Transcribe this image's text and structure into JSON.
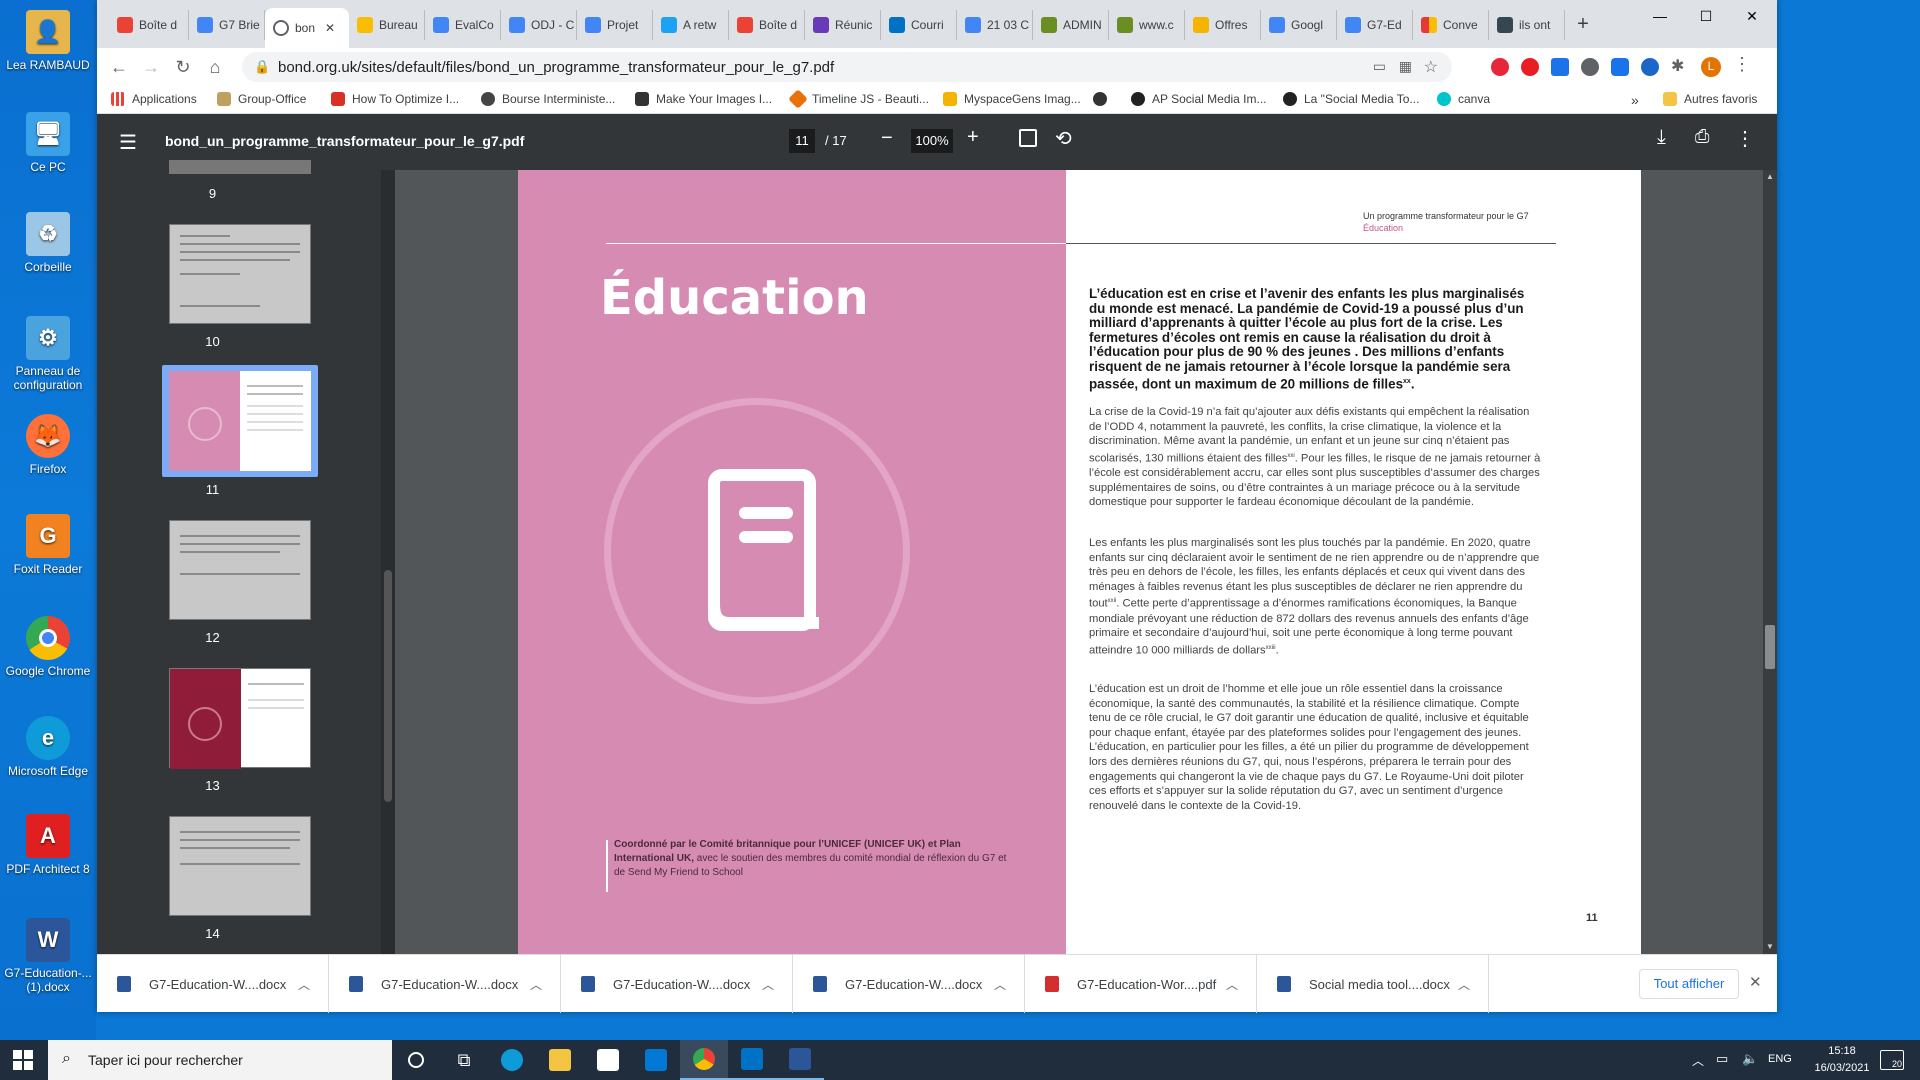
{
  "desktop": {
    "icons": [
      {
        "label": "Lea RAMBAUD",
        "color": "#e6b64c"
      },
      {
        "label": "Ce PC",
        "color": "#3aa0e8"
      },
      {
        "label": "Corbeille",
        "color": "#9cc6e6"
      },
      {
        "label": "Panneau de configuration",
        "color": "#4aa3df"
      },
      {
        "label": "Firefox",
        "color": "#ff7139"
      },
      {
        "label": "Foxit Reader",
        "color": "#f2821f"
      },
      {
        "label": "Google Chrome",
        "color": "#34a853"
      },
      {
        "label": "Microsoft Edge",
        "color": "#0f9bd7"
      },
      {
        "label": "PDF Architect 8",
        "color": "#e02020"
      },
      {
        "label": "G7-Education-... (1).docx",
        "color": "#2b579a"
      }
    ]
  },
  "browser": {
    "tabs": [
      {
        "label": "Boîte d",
        "color": "#ea4335"
      },
      {
        "label": "G7 Brie",
        "color": "#4285f4"
      },
      {
        "label": "bon",
        "color": "#5f6368"
      },
      {
        "label": "Bureau",
        "color": "#fbbc04"
      },
      {
        "label": "EvalCo",
        "color": "#4285f4"
      },
      {
        "label": "ODJ - C",
        "color": "#4285f4"
      },
      {
        "label": "Projet",
        "color": "#4285f4"
      },
      {
        "label": "A retw",
        "color": "#1da1f2"
      },
      {
        "label": "Boîte d",
        "color": "#ea4335"
      },
      {
        "label": "Réunic",
        "color": "#673ab7"
      },
      {
        "label": "Courri",
        "color": "#0072c6"
      },
      {
        "label": "21 03 C",
        "color": "#4285f4"
      },
      {
        "label": "ADMIN",
        "color": "#6b8e23"
      },
      {
        "label": "www.c",
        "color": "#6b8e23"
      },
      {
        "label": "Offres",
        "color": "#f4b400"
      },
      {
        "label": "Googl",
        "color": "#4285f4"
      },
      {
        "label": "G7-Ed",
        "color": "#4285f4"
      },
      {
        "label": "Conve",
        "color": "#e53935"
      },
      {
        "label": "ils ont",
        "color": "#37474f"
      }
    ],
    "new_tab": "+",
    "window_controls": {
      "minimize": "—",
      "maximize": "☐",
      "close": "✕"
    },
    "url": "bond.org.uk/sites/default/files/bond_un_programme_transformateur_pour_le_g7.pdf",
    "profile_initial": "L",
    "bookmarks": [
      {
        "label": "Applications",
        "color": "#5f6368"
      },
      {
        "label": "Group-Office",
        "color": "#c0a060"
      },
      {
        "label": "How To Optimize I...",
        "color": "#d93025"
      },
      {
        "label": "Bourse Interministe...",
        "color": "#444"
      },
      {
        "label": "Make Your Images I...",
        "color": "#333"
      },
      {
        "label": "Timeline JS - Beauti...",
        "color": "#e8710a"
      },
      {
        "label": "MyspaceGens Imag...",
        "color": "#f4b400"
      },
      {
        "label": "",
        "color": "#333"
      },
      {
        "label": "AP Social Media Im...",
        "color": "#222"
      },
      {
        "label": "La \"Social Media To...",
        "color": "#222"
      },
      {
        "label": "canva",
        "color": "#00c4cc"
      }
    ],
    "bookmarks_more": "»",
    "other_bookmarks": "Autres favoris"
  },
  "pdf": {
    "filename": "bond_un_programme_transformateur_pour_le_g7.pdf",
    "current_page": "11",
    "total_pages": "/ 17",
    "zoom": "100%",
    "thumbnails": [
      {
        "num": "9"
      },
      {
        "num": "10"
      },
      {
        "num": "11"
      },
      {
        "num": "12"
      },
      {
        "num": "13"
      },
      {
        "num": "14"
      }
    ],
    "page": {
      "title": "Éducation",
      "header_title": "Un programme transformateur pour le G7",
      "header_sub": "Éducation",
      "lead": "L’éducation est en crise et l’avenir des enfants les plus marginalisés du monde est menacé. La pandémie de Covid-19 a poussé plus d’un milliard d’apprenants à quitter l’école au plus fort de la crise. Les fermetures d’écoles ont remis en cause la réalisation du droit à l’éducation pour plus de 90 % des jeunes . Des millions d’enfants risquent de ne jamais retourner à l’école lorsque la pandémie sera passée, dont un maximum de 20 millions de filles",
      "lead_note": "xx",
      "para1": "La crise de la Covid-19 n’a fait qu’ajouter aux défis existants qui empêchent la réalisation de l’ODD 4, notamment la pauvreté, les conflits, la crise climatique, la violence et la discrimination. Même avant la pandémie, un enfant et un jeune sur cinq n’étaient pas scolarisés, 130 millions étaient des filles",
      "para1_note": "xxi",
      "para1_rest": ". Pour les filles, le risque de ne jamais retourner à l’école est considérablement accru, car elles sont plus susceptibles d’assumer des charges supplémentaires de soins, ou d’être contraintes à un mariage précoce ou à la servitude domestique pour supporter le fardeau économique découlant de la pandémie.",
      "para2": "Les enfants les plus marginalisés sont les plus touchés par la pandémie. En 2020, quatre enfants sur cinq déclaraient avoir le sentiment de ne rien apprendre ou de n’apprendre que très peu en dehors de l’école, les filles, les enfants déplacés et ceux qui vivent dans des ménages à faibles revenus étant les plus susceptibles de déclarer ne rien apprendre du tout",
      "para2_note": "xxii",
      "para2_rest": ". Cette perte d’apprentissage a d’énormes ramifications économiques, la Banque mondiale prévoyant une réduction de 872 dollars des revenus annuels des enfants d’âge primaire et secondaire d’aujourd’hui, soit une perte économique à long terme pouvant atteindre 10 000 milliards de dollars",
      "para2_note2": "xxiii",
      "para2_end": ".",
      "para3": "L’éducation est un droit de l’homme et elle joue un rôle essentiel dans la croissance économique, la santé des communautés, la stabilité et la résilience climatique. Compte tenu de ce rôle crucial, le G7 doit garantir une éducation de qualité, inclusive et équitable pour chaque enfant, étayée par des plateformes solides pour l’engagement des jeunes. L’éducation, en particulier pour les filles, a été un pilier du programme de développement lors des dernières réunions du G7, qui, nous l’espérons, préparera le terrain pour des engagements qui changeront la vie de chaque pays du G7. Le Royaume-Uni doit piloter ces efforts et s’appuyer sur la solide réputation du G7, avec un sentiment d’urgence renouvelé dans le contexte de la Covid-19.",
      "credit_bold": "Coordonné par le Comité britannique pour l’UNICEF (UNICEF UK) et Plan International UK,",
      "credit_rest": " avec le soutien des membres du comité mondial de réflexion du G7 et de Send My Friend to School",
      "page_number": "11"
    }
  },
  "downloads": {
    "items": [
      {
        "label": "G7-Education-W....docx",
        "type": "docx"
      },
      {
        "label": "G7-Education-W....docx",
        "type": "docx"
      },
      {
        "label": "G7-Education-W....docx",
        "type": "docx"
      },
      {
        "label": "G7-Education-W....docx",
        "type": "docx"
      },
      {
        "label": "G7-Education-Wor....pdf",
        "type": "pdf"
      },
      {
        "label": "Social media tool....docx",
        "type": "docx"
      }
    ],
    "show_all": "Tout afficher",
    "close": "✕"
  },
  "taskbar": {
    "search_placeholder": "Taper ici pour rechercher",
    "language": "ENG",
    "time": "15:18",
    "date": "16/03/2021",
    "notifications": "20"
  }
}
